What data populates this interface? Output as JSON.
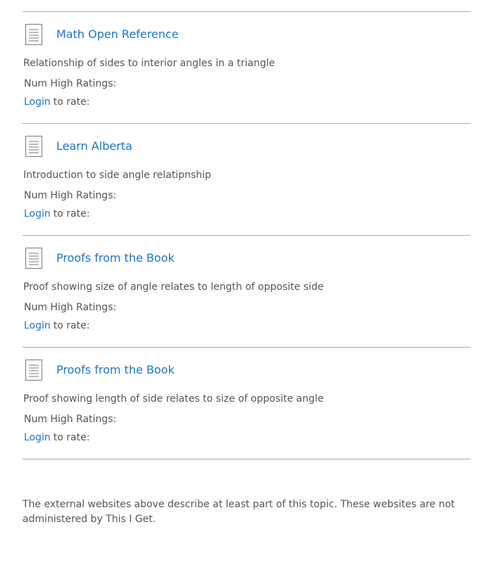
{
  "resources": [
    {
      "title": "Math Open Reference",
      "description": "Relationship of sides to interior angles in a triangle",
      "ratings_label": "Num High Ratings:",
      "login_label": "Login",
      "rate_label": "to rate:"
    },
    {
      "title": "Learn Alberta",
      "description": "Introduction to side angle relatipnship",
      "ratings_label": "Num High Ratings:",
      "login_label": "Login",
      "rate_label": "to rate:"
    },
    {
      "title": "Proofs from the Book",
      "description": "Proof showing size of angle relates to length of opposite side",
      "ratings_label": "Num High Ratings:",
      "login_label": "Login",
      "rate_label": "to rate:"
    },
    {
      "title": "Proofs from the Book",
      "description": "Proof showing length of side relates to size of opposite angle",
      "ratings_label": "Num High Ratings:",
      "login_label": "Login",
      "rate_label": "to rate:"
    }
  ],
  "icons": {
    "resource_icon": "document-icon"
  },
  "colors": {
    "link": "#1a75c6",
    "text": "#555555",
    "divider": "#a9a9a9"
  },
  "footer": {
    "note": "The external websites above describe at least part of this topic. These websites are not administered by This I Get."
  }
}
